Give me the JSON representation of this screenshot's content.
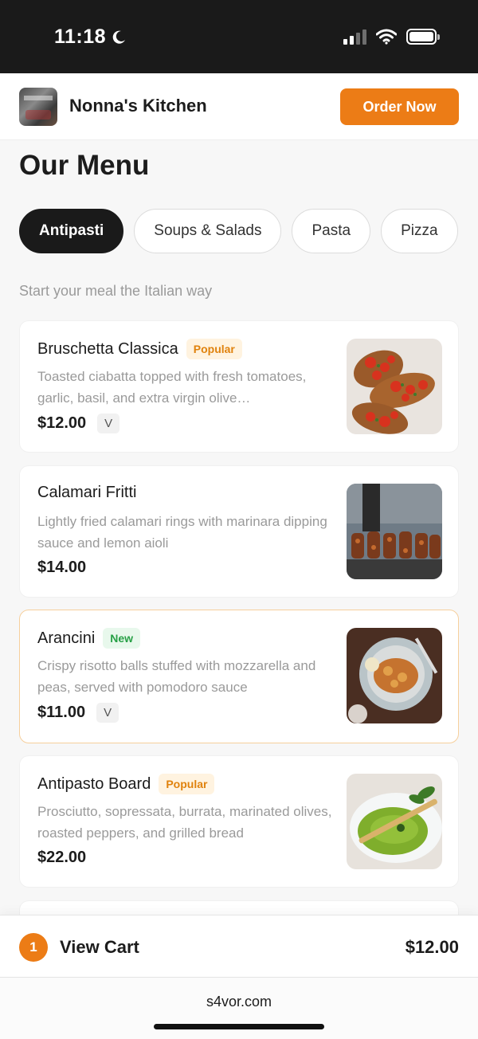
{
  "status_bar": {
    "time": "11:18",
    "moon_icon": "moon-icon",
    "signal_icon": "cellular-signal-icon",
    "wifi_icon": "wifi-icon",
    "battery_icon": "battery-icon"
  },
  "header": {
    "logo_icon": "restaurant-logo",
    "brand": "Nonna's Kitchen",
    "order_button": "Order Now"
  },
  "page": {
    "title": "Our Menu",
    "tabs": [
      {
        "label": "Antipasti",
        "active": true
      },
      {
        "label": "Soups & Salads",
        "active": false
      },
      {
        "label": "Pasta",
        "active": false
      },
      {
        "label": "Pizza",
        "active": false
      }
    ],
    "subtitle": "Start your meal the Italian way"
  },
  "items": [
    {
      "name": "Bruschetta Classica",
      "badge": "Popular",
      "description": "Toasted ciabatta topped with fresh tomatoes, garlic, basil, and extra virgin olive…",
      "price": "$12.00",
      "diet": "V",
      "image": "bruschetta-photo"
    },
    {
      "name": "Calamari Fritti",
      "badge": "",
      "description": "Lightly fried calamari rings with marinara dipping sauce and lemon aioli",
      "price": "$14.00",
      "diet": "",
      "image": "calamari-photo"
    },
    {
      "name": "Arancini",
      "badge": "New",
      "description": "Crispy risotto balls stuffed with mozzarella and peas, served with pomodoro sauce",
      "price": "$11.00",
      "diet": "V",
      "image": "arancini-photo"
    },
    {
      "name": "Antipasto Board",
      "badge": "Popular",
      "description": "Prosciutto, sopressata, burrata, marinated olives, roasted peppers, and grilled bread",
      "price": "$22.00",
      "diet": "",
      "image": "antipasto-board-photo"
    }
  ],
  "cart": {
    "count": "1",
    "label": "View Cart",
    "total": "$12.00"
  },
  "browser": {
    "url": "s4vor.com"
  },
  "colors": {
    "accent": "#ec7c16",
    "dark": "#1a1a1a",
    "muted": "#9a9a9a",
    "popular": "#e0820d",
    "new": "#27a046"
  }
}
